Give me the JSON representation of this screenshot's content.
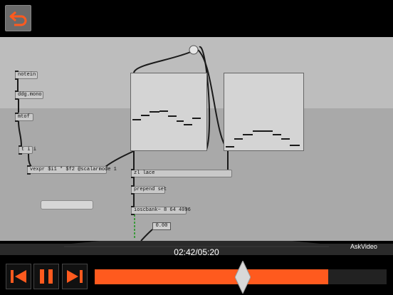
{
  "header": {
    "back_button_label": "back"
  },
  "patch": {
    "objects": {
      "notein": "notein",
      "ddg_mono": "ddg.mono",
      "mtof": "mtof",
      "t_i_i": "t i i",
      "vexpr": "vexpr $i1 * $f2 @scalarmode 1",
      "zl_lace": "zl lace",
      "prepend_set": "prepend set",
      "ioscbank": "ioscbank~ 8 64 4096"
    },
    "number_box_value": "0.00"
  },
  "player": {
    "time": "02:42/05:20",
    "brand": "AskVideo",
    "progress_fraction": 0.8,
    "accent_color": "#ff5a1e",
    "controls": [
      "skip-back-icon",
      "pause-icon",
      "skip-forward-icon"
    ]
  }
}
